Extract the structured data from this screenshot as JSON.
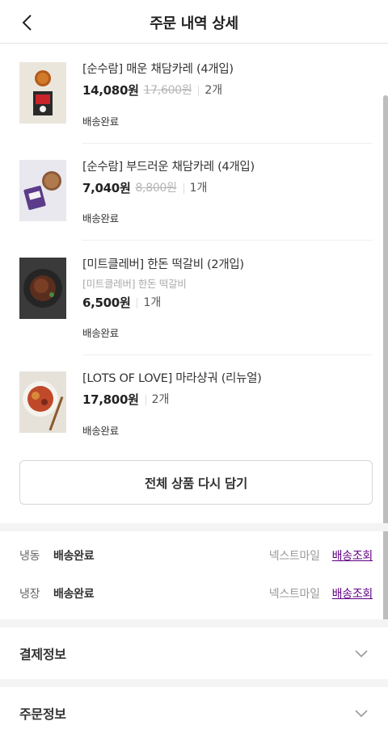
{
  "header": {
    "title": "주문 내역 상세",
    "back_icon": "chevron-left-icon"
  },
  "products": [
    {
      "name": "[순수람] 매운 채담카레 (4개입)",
      "sub": "",
      "price": "14,080원",
      "original_price": "17,600원",
      "qty": "2개",
      "status": "배송완료",
      "thumb": "spicy-curry-package"
    },
    {
      "name": "[순수람] 부드러운 채담카레 (4개입)",
      "sub": "",
      "price": "7,040원",
      "original_price": "8,800원",
      "qty": "1개",
      "status": "배송완료",
      "thumb": "mild-curry-package"
    },
    {
      "name": "[미트클레버] 한돈 떡갈비 (2개입)",
      "sub": "[미트클레버] 한돈 떡갈비",
      "price": "6,500원",
      "original_price": "",
      "qty": "1개",
      "status": "배송완료",
      "thumb": "tteokgalbi-plate"
    },
    {
      "name": "[LOTS OF LOVE] 마라샹궈 (리뉴얼)",
      "sub": "",
      "price": "17,800원",
      "original_price": "",
      "qty": "2개",
      "status": "배송완료",
      "thumb": "malaxiangguo-plate"
    }
  ],
  "recart_button": "전체 상품 다시 담기",
  "shipments": [
    {
      "type": "냉동",
      "status": "배송완료",
      "carrier": "넥스트마일",
      "link": "배송조회"
    },
    {
      "type": "냉장",
      "status": "배송완료",
      "carrier": "넥스트마일",
      "link": "배송조회"
    }
  ],
  "sections": [
    {
      "title": "결제정보",
      "icon": "chevron-down-icon"
    },
    {
      "title": "주문정보",
      "icon": "chevron-down-icon"
    }
  ],
  "colors": {
    "accent": "#5f0080",
    "divider": "#eeeeee",
    "band": "#f4f4f4"
  }
}
